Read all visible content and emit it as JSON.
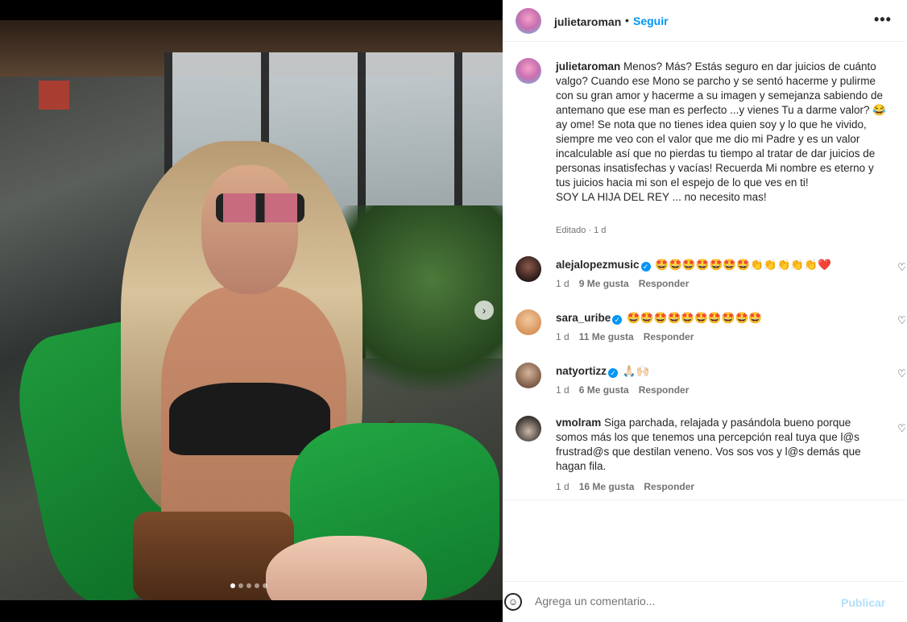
{
  "post": {
    "username": "julietaroman",
    "separator": "•",
    "follow_label": "Seguir",
    "more_icon": "more-horizontal-icon",
    "more_label": "•••",
    "caption_text": "Menos? Más? Estás seguro en dar juicios de cuánto valgo? Cuando ese Mono se parcho y se sentó hacerme y pulirme con su gran amor y hacerme a su imagen y semejanza sabiendo de antemano que ese man es perfecto ...y vienes Tu a darme valor? 😂 ay ome! Se nota que no tienes idea quien soy y lo que he vivido, siempre me veo con el valor que me dio mi Padre y es un valor incalculable así que no pierdas tu tiempo al tratar de dar juicios de personas insatisfechas y vacías! Recuerda Mi nombre es eterno y tus juicios hacia mi son el espejo de lo que ves en ti!\nSOY LA HIJA DEL REY ... no necesito mas!",
    "caption_meta": "Editado · 1 d"
  },
  "media": {
    "next_icon": "chevron-right-icon",
    "next_label": "›",
    "carousel_count": 5,
    "carousel_active": 1
  },
  "comments": [
    {
      "username": "alejalopezmusic",
      "verified": true,
      "text": "🤩🤩🤩🤩🤩🤩🤩👏👏👏👏👏❤️",
      "time": "1 d",
      "likes": "9 Me gusta",
      "reply": "Responder"
    },
    {
      "username": "sara_uribe",
      "verified": true,
      "text": "🤩🤩🤩🤩🤩🤩🤩🤩🤩🤩",
      "time": "1 d",
      "likes": "11 Me gusta",
      "reply": "Responder"
    },
    {
      "username": "natyortizz",
      "verified": true,
      "text": "🙏🏻🙌🏻",
      "time": "1 d",
      "likes": "6 Me gusta",
      "reply": "Responder"
    },
    {
      "username": "vmolram",
      "verified": false,
      "text": "Siga parchada, relajada y pasándola bueno porque somos más los que tenemos una percepción real tuya que l@s frustrad@s que destilan veneno. Vos sos vos y l@s demás que hagan fila.",
      "time": "1 d",
      "likes": "16 Me gusta",
      "reply": "Responder"
    }
  ],
  "icons": {
    "heart": "heart-outline-icon",
    "heart_glyph": "♡",
    "verified_glyph": "✓",
    "emoji": "emoji-smile-icon",
    "emoji_glyph": "☺"
  },
  "composer": {
    "placeholder": "Agrega un comentario...",
    "publish_label": "Publicar"
  },
  "colors": {
    "accent": "#0095f6",
    "publish_disabled": "#b2dffc",
    "text": "#262626",
    "muted": "#737373"
  }
}
